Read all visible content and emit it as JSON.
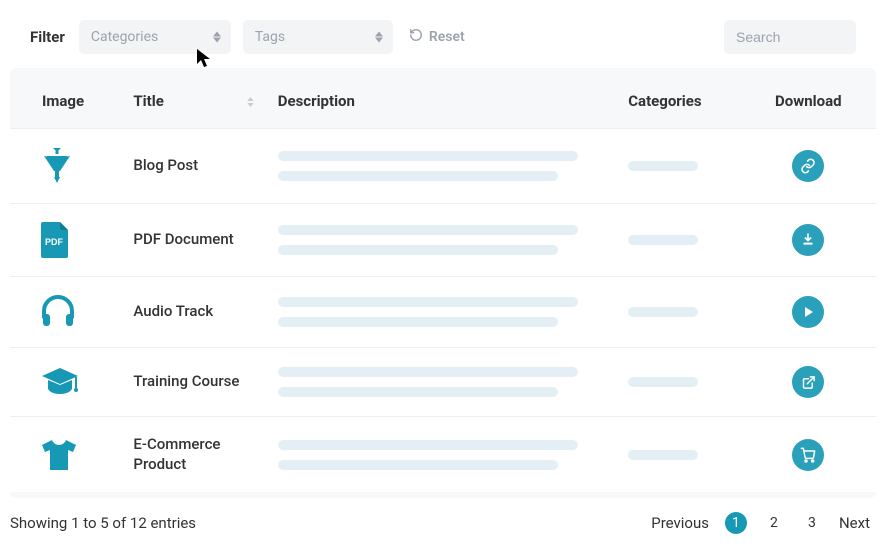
{
  "filter": {
    "label": "Filter",
    "categories_placeholder": "Categories",
    "tags_placeholder": "Tags",
    "reset_label": "Reset",
    "search_placeholder": "Search"
  },
  "columns": {
    "image": "Image",
    "title": "Title",
    "description": "Description",
    "categories": "Categories",
    "download": "Download"
  },
  "rows": [
    {
      "title": "Blog Post",
      "icon": "funnel-icon",
      "action": "link-icon"
    },
    {
      "title": "PDF Document",
      "icon": "pdf-icon",
      "action": "download-icon"
    },
    {
      "title": "Audio Track",
      "icon": "headphones-icon",
      "action": "play-icon"
    },
    {
      "title": "Training Course",
      "icon": "grad-cap-icon",
      "action": "external-icon"
    },
    {
      "title": "E-Commerce Product",
      "icon": "tshirt-icon",
      "action": "cart-icon"
    }
  ],
  "footer": {
    "info": "Showing 1 to 5 of 12 entries"
  },
  "pagination": {
    "previous": "Previous",
    "next": "Next",
    "pages": [
      "1",
      "2",
      "3"
    ],
    "active_page": 1
  },
  "colors": {
    "brand": "#1798b5",
    "skeleton": "#e3eff5"
  }
}
